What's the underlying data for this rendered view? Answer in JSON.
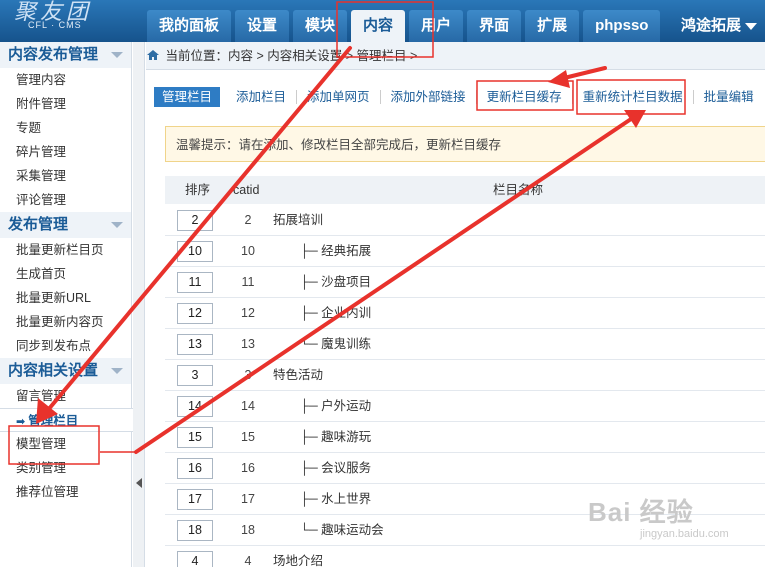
{
  "logo": {
    "mark": "聚友团",
    "sub": "CFL · CMS"
  },
  "nav": {
    "tabs": [
      {
        "label": "我的面板"
      },
      {
        "label": "设置"
      },
      {
        "label": "模块"
      },
      {
        "label": "内容",
        "active": true
      },
      {
        "label": "用户"
      },
      {
        "label": "界面"
      },
      {
        "label": "扩展"
      },
      {
        "label": "phpsso"
      }
    ],
    "site_menu": "鸿途拓展"
  },
  "sidebar": {
    "sections": [
      {
        "title": "内容发布管理",
        "items": [
          "管理内容",
          "附件管理",
          "专题",
          "碎片管理",
          "采集管理",
          "评论管理"
        ]
      },
      {
        "title": "发布管理",
        "items": [
          "批量更新栏目页",
          "生成首页",
          "批量更新URL",
          "批量更新内容页",
          "同步到发布点"
        ]
      },
      {
        "title": "内容相关设置",
        "items": [
          "留言管理",
          "管理栏目",
          "模型管理",
          "类别管理",
          "推荐位管理"
        ],
        "active_item": "管理栏目"
      }
    ]
  },
  "breadcrumb": "当前位置：内容 > 内容相关设置 > 管理栏目 >",
  "subnav": {
    "items": [
      "管理栏目",
      "添加栏目",
      "添加单网页",
      "添加外部链接",
      "更新栏目缓存",
      "重新统计栏目数据",
      "批量编辑"
    ],
    "active": "管理栏目"
  },
  "notice": "温馨提示：请在添加、修改栏目全部完成后，更新栏目缓存",
  "table": {
    "headers": {
      "order": "排序",
      "catid": "catid",
      "name": "栏目名称"
    },
    "rows": [
      {
        "order": "2",
        "catid": "2",
        "name": "拓展培训",
        "level": 0
      },
      {
        "order": "10",
        "catid": "10",
        "name": "├─ 经典拓展",
        "level": 1
      },
      {
        "order": "11",
        "catid": "11",
        "name": "├─ 沙盘项目",
        "level": 1
      },
      {
        "order": "12",
        "catid": "12",
        "name": "├─ 企业内训",
        "level": 1
      },
      {
        "order": "13",
        "catid": "13",
        "name": "└─ 魔鬼训练",
        "level": 1
      },
      {
        "order": "3",
        "catid": "3",
        "name": "特色活动",
        "level": 0
      },
      {
        "order": "14",
        "catid": "14",
        "name": "├─ 户外运动",
        "level": 1
      },
      {
        "order": "15",
        "catid": "15",
        "name": "├─ 趣味游玩",
        "level": 1
      },
      {
        "order": "16",
        "catid": "16",
        "name": "├─ 会议服务",
        "level": 1
      },
      {
        "order": "17",
        "catid": "17",
        "name": "├─ 水上世界",
        "level": 1
      },
      {
        "order": "18",
        "catid": "18",
        "name": "└─ 趣味运动会",
        "level": 1
      },
      {
        "order": "4",
        "catid": "4",
        "name": "场地介绍",
        "level": 0
      }
    ]
  },
  "watermark": {
    "main": "Bai 经验",
    "url": "jingyan.baidu.com"
  },
  "colors": {
    "accent": "#1b5c97",
    "annotation": "#e8322c"
  }
}
